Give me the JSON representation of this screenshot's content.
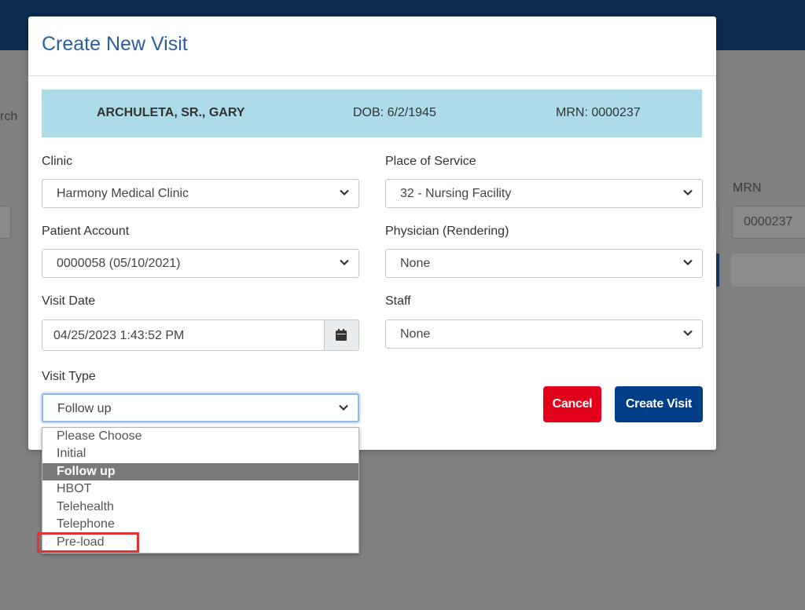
{
  "background": {
    "search_fragment": "rch",
    "mrn_label": "MRN",
    "mrn_value": "0000237"
  },
  "modal": {
    "title": "Create New Visit",
    "patient": {
      "name": "ARCHULETA, SR., GARY",
      "dob": "DOB: 6/2/1945",
      "mrn": "MRN: 0000237"
    },
    "clinic": {
      "label": "Clinic",
      "value": "Harmony Medical Clinic"
    },
    "place_of_service": {
      "label": "Place of Service",
      "value": "32 - Nursing Facility"
    },
    "patient_account": {
      "label": "Patient Account",
      "value": "0000058 (05/10/2021)"
    },
    "physician": {
      "label": "Physician (Rendering)",
      "value": "None"
    },
    "visit_date": {
      "label": "Visit Date",
      "value": "04/25/2023 1:43:52 PM"
    },
    "staff": {
      "label": "Staff",
      "value": "None"
    },
    "visit_type": {
      "label": "Visit Type",
      "value": "Follow up",
      "options": [
        "Please Choose",
        "Initial",
        "Follow up",
        "HBOT",
        "Telehealth",
        "Telephone",
        "Pre-load"
      ],
      "selected_index": 2,
      "highlighted_option": "Pre-load"
    },
    "buttons": {
      "cancel": "Cancel",
      "create": "Create Visit"
    }
  },
  "colors": {
    "topbar": "#0d2a4f",
    "title": "#2a5f9e",
    "patient_bar": "#aedbe8",
    "cancel": "#e3001b",
    "create": "#003e8a",
    "highlight": "#e5322e"
  }
}
